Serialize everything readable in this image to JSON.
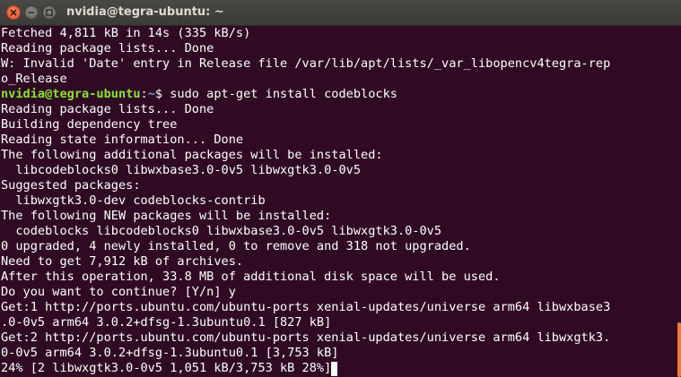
{
  "window": {
    "title": "nvidia@tegra-ubuntu: ~"
  },
  "terminal": {
    "prompt": {
      "user_host": "nvidia@tegra-ubuntu",
      "separator": ":",
      "path": "~",
      "symbol": "$ ",
      "command": "sudo apt-get install codeblocks"
    },
    "lines": [
      "Fetched 4,811 kB in 14s (335 kB/s)",
      "Reading package lists... Done",
      "W: Invalid 'Date' entry in Release file /var/lib/apt/lists/_var_libopencv4tegra-rep",
      "o_Release",
      "",
      "Reading package lists... Done",
      "Building dependency tree",
      "Reading state information... Done",
      "The following additional packages will be installed:",
      "  libcodeblocks0 libwxbase3.0-0v5 libwxgtk3.0-0v5",
      "Suggested packages:",
      "  libwxgtk3.0-dev codeblocks-contrib",
      "The following NEW packages will be installed:",
      "  codeblocks libcodeblocks0 libwxbase3.0-0v5 libwxgtk3.0-0v5",
      "0 upgraded, 4 newly installed, 0 to remove and 318 not upgraded.",
      "Need to get 7,912 kB of archives.",
      "After this operation, 33.8 MB of additional disk space will be used.",
      "Do you want to continue? [Y/n] y",
      "Get:1 http://ports.ubuntu.com/ubuntu-ports xenial-updates/universe arm64 libwxbase3",
      ".0-0v5 arm64 3.0.2+dfsg-1.3ubuntu0.1 [827 kB]",
      "Get:2 http://ports.ubuntu.com/ubuntu-ports xenial-updates/universe arm64 libwxgtk3.",
      "0-0v5 arm64 3.0.2+dfsg-1.3ubuntu0.1 [3,753 kB]",
      "24% [2 libwxgtk3.0-0v5 1,051 kB/3,753 kB 28%]"
    ]
  },
  "colors": {
    "background": "#300a24",
    "text": "#ffffff",
    "prompt_user": "#8ae234",
    "prompt_path": "#729fcf",
    "close_button": "#e95420",
    "scrollbar": "#ef7d30"
  }
}
